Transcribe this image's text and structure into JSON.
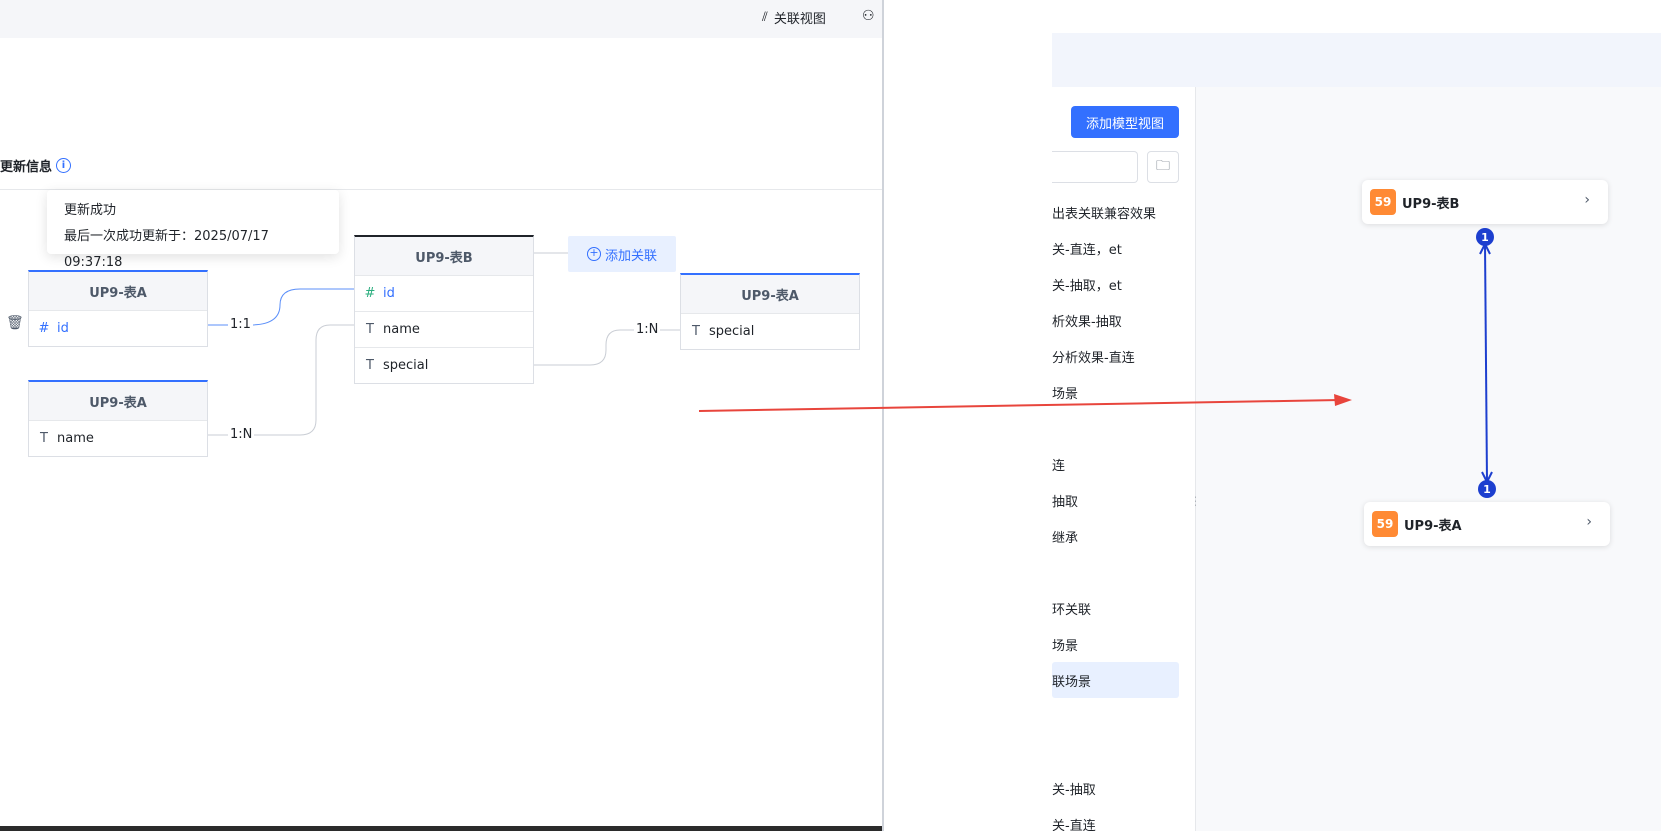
{
  "left_panel": {
    "toolbar": {
      "relation_view_label": "关联视图"
    },
    "info": {
      "label": "更新信息",
      "tooltip_line1": "更新成功",
      "tooltip_line2": "最后一次成功更新于：2025/07/17 09:37:18"
    },
    "tables": [
      {
        "title": "UP9-表A",
        "fields": [
          {
            "name": "id",
            "type": "hash"
          }
        ]
      },
      {
        "title": "UP9-表A",
        "fields": [
          {
            "name": "name",
            "type": "text"
          }
        ]
      },
      {
        "title": "UP9-表B",
        "fields": [
          {
            "name": "id",
            "type": "hash"
          },
          {
            "name": "name",
            "type": "text"
          },
          {
            "name": "special",
            "type": "text"
          }
        ]
      },
      {
        "title": "UP9-表A",
        "fields": [
          {
            "name": "special",
            "type": "text"
          }
        ]
      }
    ],
    "relations": [
      "1:1",
      "1:N",
      "1:N"
    ],
    "add_relation_label": "添加关联"
  },
  "right_panel": {
    "add_model_view_label": "添加模型视图",
    "list_items": [
      "出表关联兼容效果",
      "关-直连，et",
      "关-抽取，et",
      "析效果-抽取",
      "分析效果-直连",
      "场景",
      "连",
      "抽取",
      "继承",
      "环关联",
      "场景",
      "联场景",
      "关-抽取",
      "关-直连"
    ],
    "active_item_index": 11,
    "nodes": [
      {
        "badge": "59",
        "title": "UP9-表B"
      },
      {
        "badge": "59",
        "title": "UP9-表A"
      }
    ],
    "counts": [
      "1",
      "1"
    ]
  }
}
